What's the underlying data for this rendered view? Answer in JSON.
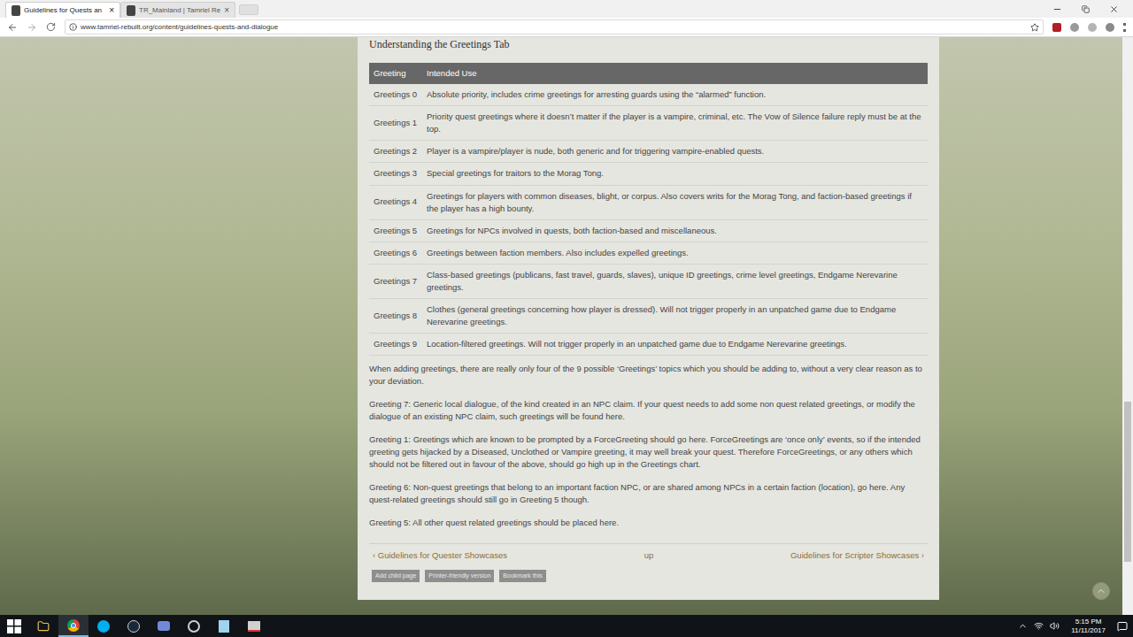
{
  "browser": {
    "tabs": [
      {
        "label": "Guidelines for Quests an",
        "selected": true,
        "close": "×"
      },
      {
        "label": "TR_Mainland | Tamriel Re",
        "selected": false,
        "close": "×"
      }
    ],
    "address": "www.tamriel-rebuilt.org/content/guidelines-quests-and-dialogue"
  },
  "page": {
    "heading": "Understanding the Greetings Tab",
    "table": {
      "columns": [
        "Greeting",
        "Intended Use"
      ],
      "rows": [
        {
          "greeting": "Greetings 0",
          "use": "Absolute priority, includes crime greetings for arresting guards using the “alarmed” function."
        },
        {
          "greeting": "Greetings 1",
          "use": "Priority quest greetings where it doesn’t matter if the player is a vampire, criminal, etc. The Vow of Silence failure reply must be at the top."
        },
        {
          "greeting": "Greetings 2",
          "use": "Player is a vampire/player is nude, both generic and for triggering vampire-enabled quests."
        },
        {
          "greeting": "Greetings 3",
          "use": "Special greetings for traitors to the Morag Tong."
        },
        {
          "greeting": "Greetings 4",
          "use": "Greetings for players with common diseases, blight, or corpus. Also covers writs for the Morag Tong, and faction-based greetings if the player has a high bounty."
        },
        {
          "greeting": "Greetings 5",
          "use": "Greetings for NPCs involved in quests, both faction-based and miscellaneous."
        },
        {
          "greeting": "Greetings 6",
          "use": "Greetings between faction members. Also includes expelled greetings."
        },
        {
          "greeting": "Greetings 7",
          "use": "Class-based greetings (publicans, fast travel, guards, slaves), unique ID greetings, crime level greetings, Endgame Nerevarine greetings."
        },
        {
          "greeting": "Greetings 8",
          "use": "Clothes (general greetings concerning how player is dressed). Will not trigger properly in an unpatched game due to Endgame Nerevarine greetings."
        },
        {
          "greeting": "Greetings 9",
          "use": "Location-filtered greetings. Will not trigger properly in an unpatched game due to Endgame Nerevarine greetings."
        }
      ]
    },
    "paragraphs": [
      "When adding greetings, there are really only four of the 9 possible ‘Greetings’ topics which you should be adding to, without a very clear reason as to your deviation.",
      "Greeting 7: Generic local dialogue, of the kind created in an NPC claim. If your quest needs to add some non quest related greetings, or modify the dialogue of an existing NPC claim, such greetings will be found here.",
      "Greeting 1: Greetings which are known to be prompted by a ForceGreeting should go here. ForceGreetings are ‘once only’ events, so if the intended greeting gets hijacked by a Diseased, Unclothed or Vampire greeting, it may well break your quest. Therefore ForceGreetings, or any others which should not be filtered out in favour of the above, should go high up in the Greetings chart.",
      "Greeting 6: Non-quest greetings that belong to an important faction NPC, or are shared among NPCs in a certain faction (location), go here. Any quest-related greetings should still go in Greeting 5 though.",
      "Greeting 5: All other quest related greetings should be placed here."
    ],
    "pager": {
      "prev": "‹ Guidelines for Quester Showcases",
      "up": "up",
      "next": "Guidelines for Scripter Showcases ›"
    },
    "links": [
      "Add child page",
      "Printer-friendly version",
      "Bookmark this"
    ]
  },
  "taskbar": {
    "time": "5:15 PM",
    "date": "11/11/2017"
  }
}
